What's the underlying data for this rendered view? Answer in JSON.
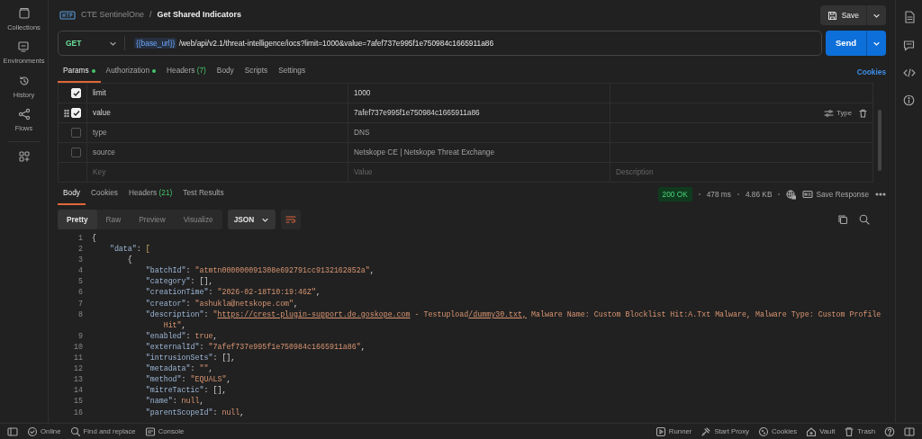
{
  "sidebar": {
    "items": [
      {
        "label": "Collections"
      },
      {
        "label": "Environments"
      },
      {
        "label": "History"
      },
      {
        "label": "Flows"
      }
    ]
  },
  "header": {
    "collection": "CTE SentinelOne",
    "separator": "/",
    "request": "Get Shared Indicators",
    "save": "Save"
  },
  "url_bar": {
    "method": "GET",
    "variable": "{{base_url}}",
    "path": "/web/api/v2.1/threat-intelligence/iocs?limit=1000&value=7afef737e995f1e750984c1665911a86",
    "send": "Send"
  },
  "request_tabs": [
    {
      "label": "Params",
      "dot": true,
      "selected": true
    },
    {
      "label": "Authorization",
      "dot": true,
      "selected": false
    },
    {
      "label": "Headers",
      "count": "(7)",
      "dot": false,
      "selected": false
    },
    {
      "label": "Body",
      "dot": false,
      "selected": false
    },
    {
      "label": "Scripts",
      "dot": false,
      "selected": false
    },
    {
      "label": "Settings",
      "dot": false,
      "selected": false
    }
  ],
  "cookies_link": "Cookies",
  "params": {
    "rows": [
      {
        "key": "limit",
        "value": "1000",
        "checked": true,
        "hovered": false
      },
      {
        "key": "value",
        "value": "7afef737e995f1e750984c1665911a86",
        "checked": true,
        "hovered": true
      },
      {
        "key": "type",
        "value": "DNS",
        "checked": false,
        "hovered": false
      },
      {
        "key": "source",
        "value": "Netskope CE | Netskope Threat Exchange",
        "checked": false,
        "hovered": false
      }
    ],
    "new_row": {
      "key_placeholder": "Key",
      "value_placeholder": "Value",
      "description_placeholder": "Description"
    },
    "row_action": "Type"
  },
  "response_tabs": [
    {
      "label": "Body",
      "selected": true
    },
    {
      "label": "Cookies",
      "selected": false
    },
    {
      "label": "Headers",
      "count": "(21)",
      "selected": false
    },
    {
      "label": "Test Results",
      "selected": false
    }
  ],
  "response_meta": {
    "status": "200 OK",
    "time": "478 ms",
    "size": "4.86 KB",
    "save": "Save Response"
  },
  "view_modes": [
    {
      "label": "Pretty",
      "selected": true
    },
    {
      "label": "Raw",
      "selected": false
    },
    {
      "label": "Preview",
      "selected": false
    },
    {
      "label": "Visualize",
      "selected": false
    }
  ],
  "format": "JSON",
  "code_lines": [
    {
      "number": "1",
      "tokens": [
        {
          "kind": "punct",
          "text": "{"
        }
      ]
    },
    {
      "number": "2",
      "tokens": [
        {
          "kind": "key",
          "text": "    \"data\""
        },
        {
          "kind": "punct",
          "text": ": "
        },
        {
          "kind": "bracket",
          "text": "["
        }
      ]
    },
    {
      "number": "3",
      "tokens": [
        {
          "kind": "punct",
          "text": "        {"
        }
      ]
    },
    {
      "number": "4",
      "tokens": [
        {
          "kind": "key",
          "text": "            \"batchId\""
        },
        {
          "kind": "punct",
          "text": ": "
        },
        {
          "kind": "string",
          "text": "\"atmtn000000091308e692791cc9132162852a\""
        },
        {
          "kind": "punct",
          "text": ","
        }
      ]
    },
    {
      "number": "5",
      "tokens": [
        {
          "kind": "key",
          "text": "            \"category\""
        },
        {
          "kind": "punct",
          "text": ": [],"
        }
      ]
    },
    {
      "number": "6",
      "tokens": [
        {
          "kind": "key",
          "text": "            \"creationTime\""
        },
        {
          "kind": "punct",
          "text": ": "
        },
        {
          "kind": "string",
          "text": "\"2026-02-18T10:19:46Z\""
        },
        {
          "kind": "punct",
          "text": ","
        }
      ]
    },
    {
      "number": "7",
      "tokens": [
        {
          "kind": "key",
          "text": "            \"creator\""
        },
        {
          "kind": "punct",
          "text": ": "
        },
        {
          "kind": "string",
          "text": "\"ashukla@netskope.com\""
        },
        {
          "kind": "punct",
          "text": ","
        }
      ]
    },
    {
      "number": "8",
      "tokens": [
        {
          "kind": "key",
          "text": "            \"description\""
        },
        {
          "kind": "punct",
          "text": ": "
        },
        {
          "kind": "string",
          "text": "\""
        },
        {
          "kind": "link",
          "text": "https://crest-plugin-support.de.goskope.com"
        },
        {
          "kind": "string",
          "text": " - Testupload"
        },
        {
          "kind": "link",
          "text": "/dummy30.txt,"
        },
        {
          "kind": "string",
          "text": " Malware Name: Custom Blocklist Hit:A.Txt Malware, Malware Type: Custom Profile"
        }
      ]
    },
    {
      "tokens": [
        {
          "kind": "string",
          "text": "                Hit\""
        },
        {
          "kind": "punct",
          "text": ","
        }
      ]
    },
    {
      "number": "9",
      "tokens": [
        {
          "kind": "key",
          "text": "            \"enabled\""
        },
        {
          "kind": "punct",
          "text": ": "
        },
        {
          "kind": "literal",
          "text": "true"
        },
        {
          "kind": "punct",
          "text": ","
        }
      ]
    },
    {
      "number": "10",
      "tokens": [
        {
          "kind": "key",
          "text": "            \"externalId\""
        },
        {
          "kind": "punct",
          "text": ": "
        },
        {
          "kind": "string",
          "text": "\"7afef737e995f1e750984c1665911a86\""
        },
        {
          "kind": "punct",
          "text": ","
        }
      ]
    },
    {
      "number": "11",
      "tokens": [
        {
          "kind": "key",
          "text": "            \"intrusionSets\""
        },
        {
          "kind": "punct",
          "text": ": [],"
        }
      ]
    },
    {
      "number": "12",
      "tokens": [
        {
          "kind": "key",
          "text": "            \"metadata\""
        },
        {
          "kind": "punct",
          "text": ": "
        },
        {
          "kind": "string",
          "text": "\"\""
        },
        {
          "kind": "punct",
          "text": ","
        }
      ]
    },
    {
      "number": "13",
      "tokens": [
        {
          "kind": "key",
          "text": "            \"method\""
        },
        {
          "kind": "punct",
          "text": ": "
        },
        {
          "kind": "string",
          "text": "\"EQUALS\""
        },
        {
          "kind": "punct",
          "text": ","
        }
      ]
    },
    {
      "number": "14",
      "tokens": [
        {
          "kind": "key",
          "text": "            \"mitreTactic\""
        },
        {
          "kind": "punct",
          "text": ": [],"
        }
      ]
    },
    {
      "number": "15",
      "tokens": [
        {
          "kind": "key",
          "text": "            \"name\""
        },
        {
          "kind": "punct",
          "text": ": "
        },
        {
          "kind": "literal",
          "text": "null"
        },
        {
          "kind": "punct",
          "text": ","
        }
      ]
    },
    {
      "number": "16",
      "tokens": [
        {
          "kind": "key",
          "text": "            \"parentScopeId\""
        },
        {
          "kind": "punct",
          "text": ": "
        },
        {
          "kind": "literal",
          "text": "null"
        },
        {
          "kind": "punct",
          "text": ","
        }
      ]
    }
  ],
  "status_bar": {
    "left": [
      {
        "label": "Online"
      },
      {
        "label": "Find and replace"
      },
      {
        "label": "Console"
      }
    ],
    "right": [
      {
        "label": "Runner"
      },
      {
        "label": "Start Proxy"
      },
      {
        "label": "Cookies"
      },
      {
        "label": "Vault"
      },
      {
        "label": "Trash"
      }
    ]
  }
}
